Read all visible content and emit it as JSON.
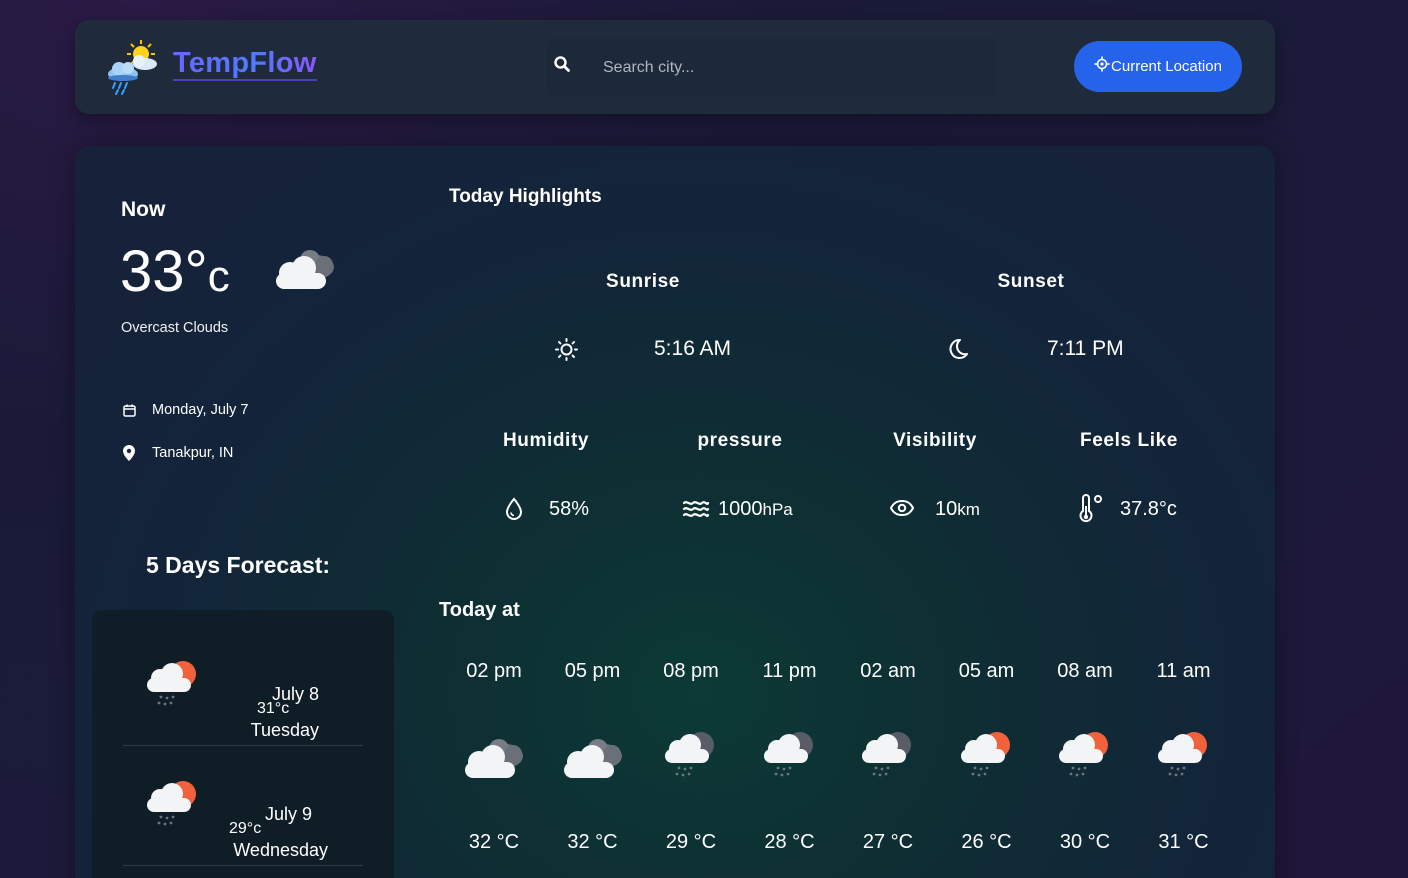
{
  "header": {
    "app_name": "TempFlow",
    "search_placeholder": "Search city...",
    "location_button": "Current Location"
  },
  "now": {
    "title": "Now",
    "temp": "33°",
    "unit": "c",
    "condition": "Overcast Clouds",
    "icon": "overcast-clouds-icon",
    "date": "Monday, July 7",
    "location": "Tanakpur, IN"
  },
  "forecast": {
    "title": "5 Days Forecast:",
    "items": [
      {
        "temp": "31°c",
        "date": "July 8",
        "day": "Tuesday",
        "icon": "rain-sun-cloud-icon"
      },
      {
        "temp": "29°c",
        "date": "July 9",
        "day": "Wednesday",
        "icon": "rain-sun-cloud-icon"
      }
    ]
  },
  "highlights": {
    "title": "Today Highlights",
    "sunrise_label": "Sunrise",
    "sunrise_value": "5:16 AM",
    "sunset_label": "Sunset",
    "sunset_value": "7:11 PM",
    "humidity_label": "Humidity",
    "humidity_value": "58%",
    "pressure_label": "pressure",
    "pressure_value": "1000",
    "pressure_unit": "hPa",
    "visibility_label": "Visibility",
    "visibility_value": "10",
    "visibility_unit": "km",
    "feels_label": "Feels Like",
    "feels_value": "37.8°c"
  },
  "today": {
    "title": "Today at",
    "hours": [
      {
        "time": "02 pm",
        "temp": "32 °C",
        "icon": "overcast-clouds-icon"
      },
      {
        "time": "05 pm",
        "temp": "32 °C",
        "icon": "overcast-clouds-icon"
      },
      {
        "time": "08 pm",
        "temp": "29 °C",
        "icon": "rain-night-cloud-icon"
      },
      {
        "time": "11 pm",
        "temp": "28 °C",
        "icon": "rain-night-cloud-icon"
      },
      {
        "time": "02 am",
        "temp": "27 °C",
        "icon": "rain-night-cloud-icon"
      },
      {
        "time": "05 am",
        "temp": "26 °C",
        "icon": "rain-sun-cloud-icon"
      },
      {
        "time": "08 am",
        "temp": "30 °C",
        "icon": "rain-sun-cloud-icon"
      },
      {
        "time": "11 am",
        "temp": "31 °C",
        "icon": "rain-sun-cloud-icon"
      }
    ]
  },
  "colors": {
    "accent": "#2563eb",
    "brand_gradient_start": "#6a66ff",
    "brand_gradient_end": "#8a56ff",
    "header_bg": "#1f2a3b",
    "card_bg": "#0f1d26"
  }
}
